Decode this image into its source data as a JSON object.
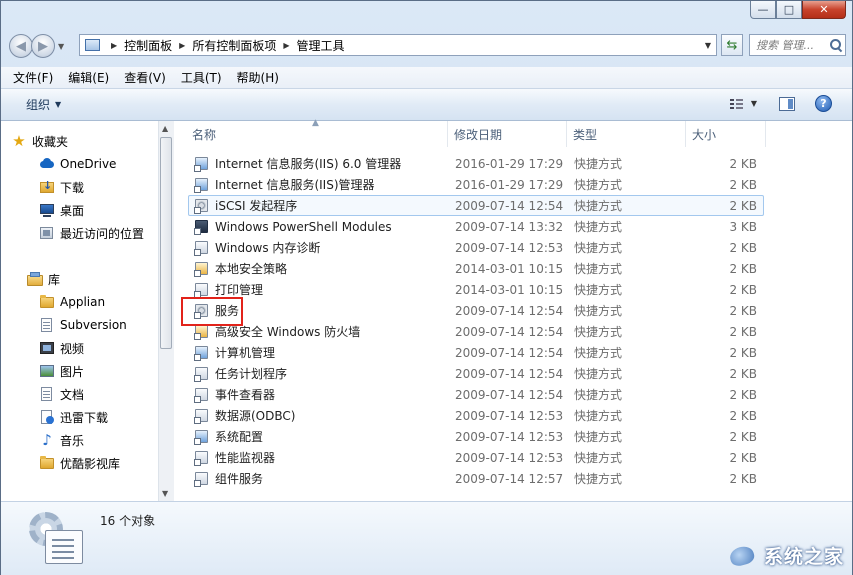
{
  "window": {
    "minimize_glyph": "—",
    "maximize_glyph": "□",
    "close_glyph": "✕"
  },
  "navigation": {
    "back_icon": "back-arrow-icon",
    "forward_icon": "forward-arrow-icon",
    "breadcrumbs": [
      "控制面板",
      "所有控制面板项",
      "管理工具"
    ],
    "search_placeholder": "搜索 管理...",
    "refresh_icon": "refresh-icon"
  },
  "menubar": {
    "items": [
      "文件(F)",
      "编辑(E)",
      "查看(V)",
      "工具(T)",
      "帮助(H)"
    ]
  },
  "toolbar": {
    "organize_label": "组织",
    "help_glyph": "?"
  },
  "sidebar": {
    "favorites": {
      "label": "收藏夹",
      "items": [
        "OneDrive",
        "下载",
        "桌面",
        "最近访问的位置"
      ]
    },
    "libraries": {
      "label": "库",
      "items": [
        "Applian",
        "Subversion",
        "视频",
        "图片",
        "文档",
        "迅雷下载",
        "音乐",
        "优酷影视库"
      ]
    }
  },
  "filelist": {
    "columns": [
      "名称",
      "修改日期",
      "类型",
      "大小"
    ],
    "rows": [
      {
        "name": "Internet 信息服务(IIS) 6.0 管理器",
        "date": "2016-01-29 17:29",
        "type": "快捷方式",
        "size": "2 KB",
        "icon": "iis6-manager-icon"
      },
      {
        "name": "Internet 信息服务(IIS)管理器",
        "date": "2016-01-29 17:29",
        "type": "快捷方式",
        "size": "2 KB",
        "icon": "iis-manager-icon"
      },
      {
        "name": "iSCSI 发起程序",
        "date": "2009-07-14 12:54",
        "type": "快捷方式",
        "size": "2 KB",
        "icon": "iscsi-icon"
      },
      {
        "name": "Windows PowerShell Modules",
        "date": "2009-07-14 13:32",
        "type": "快捷方式",
        "size": "3 KB",
        "icon": "powershell-icon"
      },
      {
        "name": "Windows 内存诊断",
        "date": "2009-07-14 12:53",
        "type": "快捷方式",
        "size": "2 KB",
        "icon": "memory-diagnostic-icon"
      },
      {
        "name": "本地安全策略",
        "date": "2014-03-01 10:15",
        "type": "快捷方式",
        "size": "2 KB",
        "icon": "security-policy-icon"
      },
      {
        "name": "打印管理",
        "date": "2014-03-01 10:15",
        "type": "快捷方式",
        "size": "2 KB",
        "icon": "print-management-icon"
      },
      {
        "name": "服务",
        "date": "2009-07-14 12:54",
        "type": "快捷方式",
        "size": "2 KB",
        "icon": "services-icon"
      },
      {
        "name": "高级安全 Windows 防火墙",
        "date": "2009-07-14 12:54",
        "type": "快捷方式",
        "size": "2 KB",
        "icon": "firewall-icon"
      },
      {
        "name": "计算机管理",
        "date": "2009-07-14 12:54",
        "type": "快捷方式",
        "size": "2 KB",
        "icon": "computer-management-icon"
      },
      {
        "name": "任务计划程序",
        "date": "2009-07-14 12:54",
        "type": "快捷方式",
        "size": "2 KB",
        "icon": "task-scheduler-icon"
      },
      {
        "name": "事件查看器",
        "date": "2009-07-14 12:54",
        "type": "快捷方式",
        "size": "2 KB",
        "icon": "event-viewer-icon"
      },
      {
        "name": "数据源(ODBC)",
        "date": "2009-07-14 12:53",
        "type": "快捷方式",
        "size": "2 KB",
        "icon": "odbc-icon"
      },
      {
        "name": "系统配置",
        "date": "2009-07-14 12:53",
        "type": "快捷方式",
        "size": "2 KB",
        "icon": "system-config-icon"
      },
      {
        "name": "性能监视器",
        "date": "2009-07-14 12:53",
        "type": "快捷方式",
        "size": "2 KB",
        "icon": "performance-monitor-icon"
      },
      {
        "name": "组件服务",
        "date": "2009-07-14 12:57",
        "type": "快捷方式",
        "size": "2 KB",
        "icon": "component-services-icon"
      }
    ]
  },
  "details": {
    "object_count": "16 个对象"
  },
  "watermark": {
    "text": "系统之家"
  }
}
